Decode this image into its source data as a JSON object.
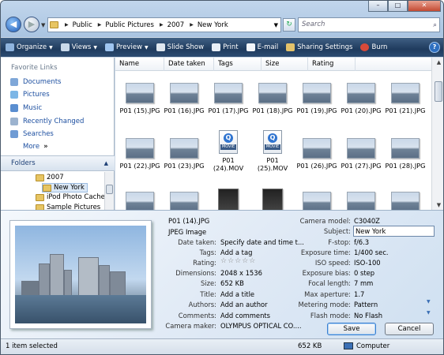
{
  "window": {
    "caption_buttons": {
      "minimize": "–",
      "maximize": "□",
      "close": "✕"
    }
  },
  "address_bar": {
    "crumbs": [
      "Public",
      "Public Pictures",
      "2007",
      "New York"
    ],
    "search_placeholder": "Search"
  },
  "toolbar": {
    "items": [
      {
        "label": "Organize",
        "icon": "organize-icon",
        "dropdown": true
      },
      {
        "label": "Views",
        "icon": "views-icon",
        "dropdown": true
      },
      {
        "label": "Preview",
        "icon": "preview-icon",
        "dropdown": true
      },
      {
        "label": "Slide Show",
        "icon": "slideshow-icon"
      },
      {
        "label": "Print",
        "icon": "print-icon"
      },
      {
        "label": "E-mail",
        "icon": "email-icon"
      },
      {
        "label": "Sharing Settings",
        "icon": "sharing-icon"
      },
      {
        "label": "Burn",
        "icon": "burn-icon"
      }
    ]
  },
  "nav_pane": {
    "favorites_title": "Favorite Links",
    "favorites": [
      "Documents",
      "Pictures",
      "Music",
      "Recently Changed",
      "Searches"
    ],
    "more": "More",
    "folders_title": "Folders",
    "tree": [
      "2007",
      "New York",
      "iPod Photo Cache",
      "Sample Pictures"
    ]
  },
  "columns": [
    "Name",
    "Date taken",
    "Tags",
    "Size",
    "Rating"
  ],
  "files": {
    "row1": [
      "P01 (15).JPG",
      "P01 (16).JPG",
      "P01 (17).JPG",
      "P01 (18).JPG",
      "P01 (19).JPG",
      "P01 (20).JPG",
      "P01 (21).JPG"
    ],
    "row2": [
      "P01 (22).JPG",
      "P01 (23).JPG",
      "P01 (24).MOV",
      "P01 (25).MOV",
      "P01 (26).JPG",
      "P01 (27).JPG",
      "P01 (28).JPG"
    ]
  },
  "details": {
    "filename": "P01 (14).JPG",
    "filetype": "JPEG Image",
    "left": [
      {
        "label": "Date taken:",
        "value": "Specify date and time t..."
      },
      {
        "label": "Tags:",
        "value": "Add a tag"
      },
      {
        "label": "Rating:",
        "value": "☆☆☆☆☆"
      },
      {
        "label": "Dimensions:",
        "value": "2048 x 1536"
      },
      {
        "label": "Size:",
        "value": "652 KB"
      },
      {
        "label": "Title:",
        "value": "Add a title"
      },
      {
        "label": "Authors:",
        "value": "Add an author"
      },
      {
        "label": "Comments:",
        "value": "Add comments"
      },
      {
        "label": "Camera maker:",
        "value": "OLYMPUS OPTICAL CO...."
      }
    ],
    "right": [
      {
        "label": "Camera model:",
        "value": "C3040Z"
      },
      {
        "label": "Subject:",
        "value": "New York"
      },
      {
        "label": "F-stop:",
        "value": "f/6.3"
      },
      {
        "label": "Exposure time:",
        "value": "1/400 sec."
      },
      {
        "label": "ISO speed:",
        "value": "ISO-100"
      },
      {
        "label": "Exposure bias:",
        "value": "0 step"
      },
      {
        "label": "Focal length:",
        "value": "7 mm"
      },
      {
        "label": "Max aperture:",
        "value": "1.7"
      },
      {
        "label": "Metering mode:",
        "value": "Pattern"
      },
      {
        "label": "Flash mode:",
        "value": "No Flash"
      }
    ],
    "save": "Save",
    "cancel": "Cancel"
  },
  "status": {
    "selected": "1 item selected",
    "size": "652 KB",
    "zone": "Computer"
  }
}
